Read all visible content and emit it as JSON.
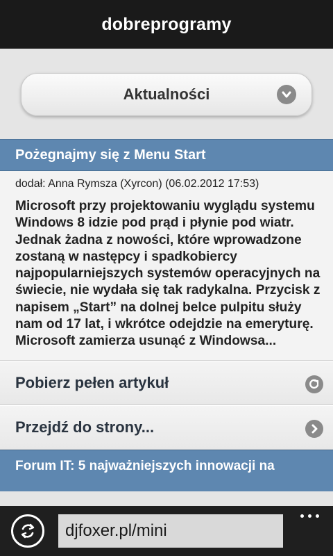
{
  "header": {
    "title": "dobreprogramy"
  },
  "category_select": {
    "selected": "Aktualności"
  },
  "article": {
    "title": "Pożegnajmy się z Menu Start",
    "meta": "dodał: Anna Rymsza (Xyrcon) (06.02.2012 17:53)",
    "summary": "Microsoft przy projektowaniu wyglądu systemu Windows 8 idzie pod prąd i płynie pod wiatr. Jednak żadna z nowości, które wprowadzone zostaną w następcy i spadkobiercy najpopularniejszych systemów operacyjnych na świecie, nie wydała się tak radykalna. Przycisk z napisem „Start” na dolnej belce pulpitu służy nam od 17 lat, i wkrótce odejdzie na emeryturę. Microsoft zamierza usunąć z Windowsa..."
  },
  "actions": {
    "full_article": "Pobierz pełen artykuł",
    "go_to_page": "Przejdź do strony..."
  },
  "next_article": {
    "title": "Forum IT: 5 najważniejszych innowacji na"
  },
  "appbar": {
    "address": "djfoxer.pl/mini"
  },
  "icons": {
    "refresh": "refresh-icon",
    "chevron": "chevron-down-icon",
    "download": "download-arrow-icon",
    "forward": "chevron-right-icon",
    "more": "more-icon"
  },
  "colors": {
    "header_bg": "#1a1a1a",
    "section_blue": "#5e87b0",
    "appbar_bg": "#1f1f1f"
  }
}
